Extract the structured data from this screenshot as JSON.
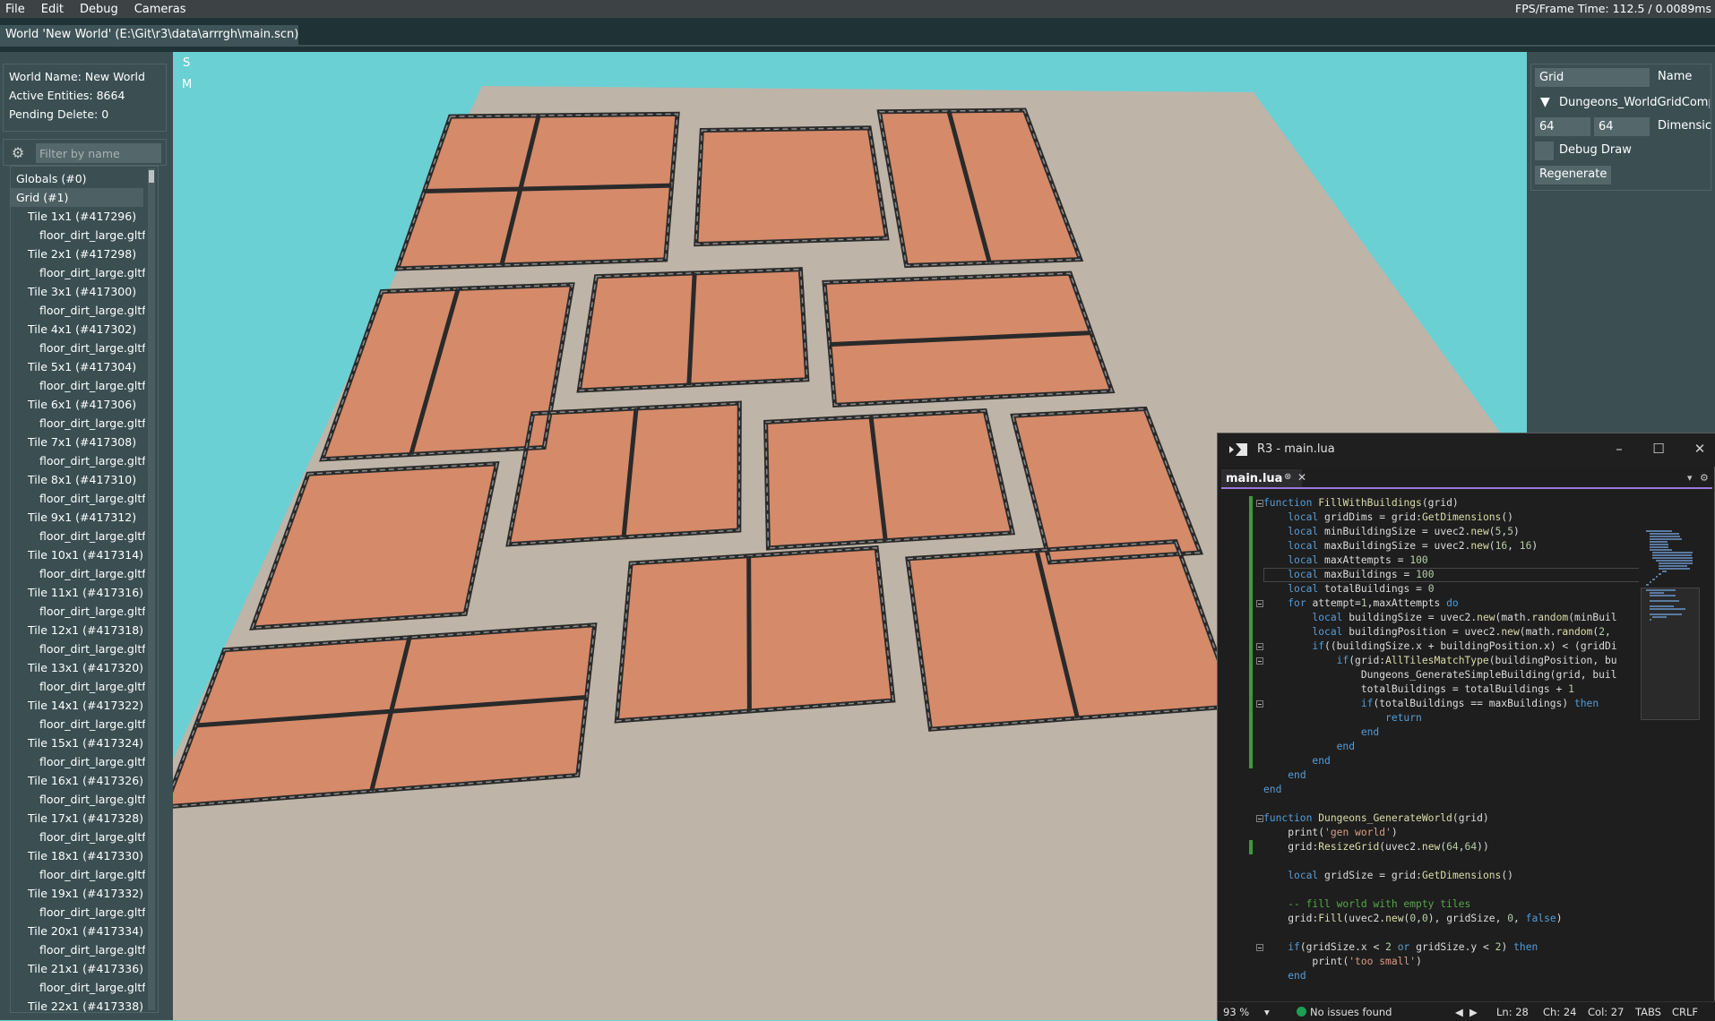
{
  "menubar": {
    "items": [
      "File",
      "Edit",
      "Debug",
      "Cameras"
    ],
    "fps": "FPS/Frame Time: 112.5 / 0.0089ms"
  },
  "world_tab": {
    "label": "World 'New World' (E:\\Git\\r3\\data\\arrrgh\\main.scn)"
  },
  "world_info": {
    "name": "World Name: New World",
    "entities": "Active Entities: 8664",
    "pending": "Pending Delete: 0"
  },
  "filter": {
    "placeholder": "Filter by name",
    "icon": "gear-icon"
  },
  "tree": [
    {
      "label": "Globals (#0)",
      "level": 0
    },
    {
      "label": "Grid (#1)",
      "level": 0,
      "selected": true
    },
    {
      "label": "Tile 1x1 (#417296)",
      "level": 1
    },
    {
      "label": "floor_dirt_large.gltf",
      "level": 2
    },
    {
      "label": "Tile 2x1 (#417298)",
      "level": 1
    },
    {
      "label": "floor_dirt_large.gltf",
      "level": 2
    },
    {
      "label": "Tile 3x1 (#417300)",
      "level": 1
    },
    {
      "label": "floor_dirt_large.gltf",
      "level": 2
    },
    {
      "label": "Tile 4x1 (#417302)",
      "level": 1
    },
    {
      "label": "floor_dirt_large.gltf",
      "level": 2
    },
    {
      "label": "Tile 5x1 (#417304)",
      "level": 1
    },
    {
      "label": "floor_dirt_large.gltf",
      "level": 2
    },
    {
      "label": "Tile 6x1 (#417306)",
      "level": 1
    },
    {
      "label": "floor_dirt_large.gltf",
      "level": 2
    },
    {
      "label": "Tile 7x1 (#417308)",
      "level": 1
    },
    {
      "label": "floor_dirt_large.gltf",
      "level": 2
    },
    {
      "label": "Tile 8x1 (#417310)",
      "level": 1
    },
    {
      "label": "floor_dirt_large.gltf",
      "level": 2
    },
    {
      "label": "Tile 9x1 (#417312)",
      "level": 1
    },
    {
      "label": "floor_dirt_large.gltf",
      "level": 2
    },
    {
      "label": "Tile 10x1 (#417314)",
      "level": 1
    },
    {
      "label": "floor_dirt_large.gltf",
      "level": 2
    },
    {
      "label": "Tile 11x1 (#417316)",
      "level": 1
    },
    {
      "label": "floor_dirt_large.gltf",
      "level": 2
    },
    {
      "label": "Tile 12x1 (#417318)",
      "level": 1
    },
    {
      "label": "floor_dirt_large.gltf",
      "level": 2
    },
    {
      "label": "Tile 13x1 (#417320)",
      "level": 1
    },
    {
      "label": "floor_dirt_large.gltf",
      "level": 2
    },
    {
      "label": "Tile 14x1 (#417322)",
      "level": 1
    },
    {
      "label": "floor_dirt_large.gltf",
      "level": 2
    },
    {
      "label": "Tile 15x1 (#417324)",
      "level": 1
    },
    {
      "label": "floor_dirt_large.gltf",
      "level": 2
    },
    {
      "label": "Tile 16x1 (#417326)",
      "level": 1
    },
    {
      "label": "floor_dirt_large.gltf",
      "level": 2
    },
    {
      "label": "Tile 17x1 (#417328)",
      "level": 1
    },
    {
      "label": "floor_dirt_large.gltf",
      "level": 2
    },
    {
      "label": "Tile 18x1 (#417330)",
      "level": 1
    },
    {
      "label": "floor_dirt_large.gltf",
      "level": 2
    },
    {
      "label": "Tile 19x1 (#417332)",
      "level": 1
    },
    {
      "label": "floor_dirt_large.gltf",
      "level": 2
    },
    {
      "label": "Tile 20x1 (#417334)",
      "level": 1
    },
    {
      "label": "floor_dirt_large.gltf",
      "level": 2
    },
    {
      "label": "Tile 21x1 (#417336)",
      "level": 1
    },
    {
      "label": "floor_dirt_large.gltf",
      "level": 2
    },
    {
      "label": "Tile 22x1 (#417338)",
      "level": 1
    }
  ],
  "viewport": {
    "overlay_s": "S",
    "overlay_m": "M",
    "sky_color": "#6ad0d4",
    "ground_color": "#bfb4a8",
    "floor_color": "#d58a6a",
    "wall_color": "#2a2a2a"
  },
  "inspector": {
    "component_field": "Grid",
    "name_label": "Name",
    "component_title": "Dungeons_WorldGridComp",
    "dim_x": "64",
    "dim_y": "64",
    "dim_label": "Dimensic",
    "debug_draw_label": "Debug Draw",
    "regenerate_label": "Regenerate"
  },
  "editor": {
    "title": "R3 - main.lua",
    "tab": "main.lua",
    "code_lines": [
      "function FillWithBuildings(grid)",
      "    local gridDims = grid:GetDimensions()",
      "    local minBuildingSize = uvec2.new(5,5)",
      "    local maxBuildingSize = uvec2.new(16, 16)",
      "    local maxAttempts = 100",
      "    local maxBuildings = 100",
      "    local totalBuildings = 0",
      "    for attempt=1,maxAttempts do",
      "        local buildingSize = uvec2.new(math.random(minBuil",
      "        local buildingPosition = uvec2.new(math.random(2, ",
      "        if((buildingSize.x + buildingPosition.x) < (gridDi",
      "            if(grid:AllTilesMatchType(buildingPosition, bu",
      "                Dungeons_GenerateSimpleBuilding(grid, buil",
      "                totalBuildings = totalBuildings + 1",
      "                if(totalBuildings == maxBuildings) then",
      "                    return",
      "                end",
      "            end",
      "        end",
      "    end",
      "end",
      "",
      "function Dungeons_GenerateWorld(grid)",
      "    print('gen world')",
      "    grid:ResizeGrid(uvec2.new(64,64))",
      "",
      "    local gridSize = grid:GetDimensions()",
      "",
      "    -- fill world with empty tiles",
      "    grid:Fill(uvec2.new(0,0), gridSize, 0, false)",
      "",
      "    if(gridSize.x < 2 or gridSize.y < 2) then",
      "        print('too small')",
      "    end"
    ],
    "status": {
      "zoom": "93 %",
      "issues": "No issues found",
      "ln": "Ln: 28",
      "ch": "Ch: 24",
      "col": "Col: 27",
      "tabs": "TABS",
      "eol": "CRLF"
    }
  }
}
